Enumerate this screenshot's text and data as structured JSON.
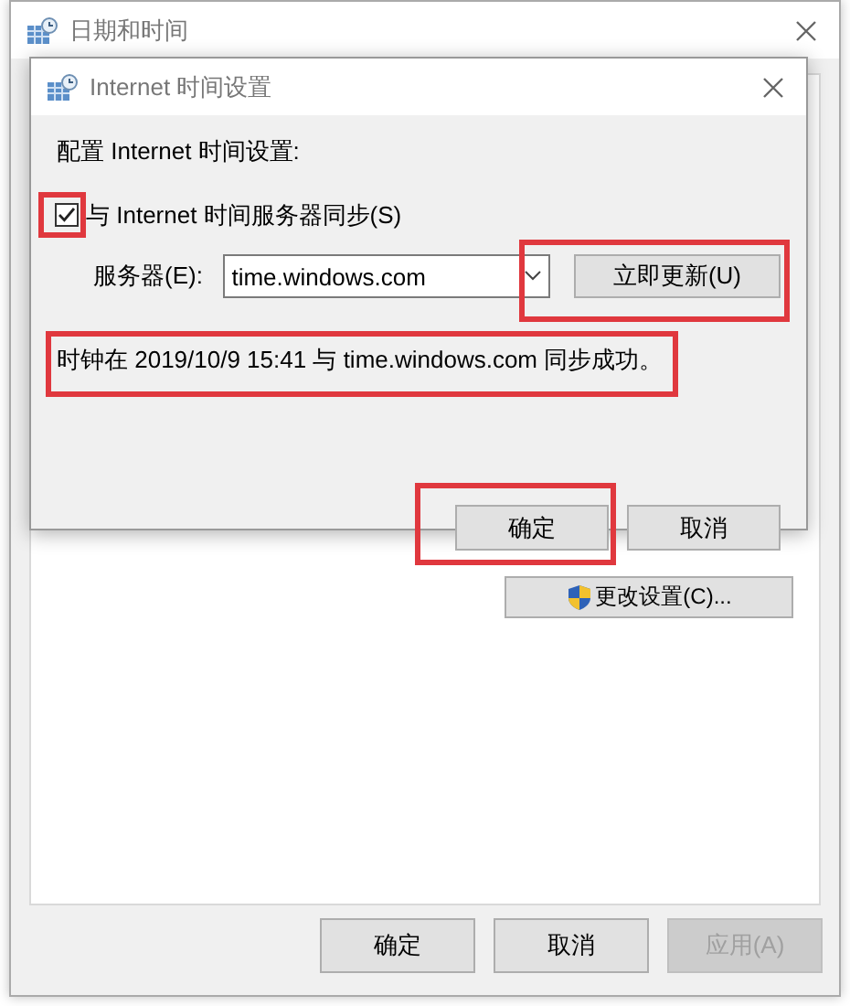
{
  "window": {
    "title": "日期和时间",
    "change_settings_button": "更改设置(C)...",
    "buttons": [
      {
        "label": "确定",
        "disabled": false
      },
      {
        "label": "取消",
        "disabled": false
      },
      {
        "label": "应用(A)",
        "disabled": true
      }
    ]
  },
  "dialog": {
    "title": "Internet 时间设置",
    "heading": "配置 Internet 时间设置:",
    "sync": {
      "label": "与 Internet 时间服务器同步(S)",
      "checked": true,
      "highlighted": true
    },
    "server_label": "服务器(E):",
    "server_value": "time.windows.com",
    "update_button": {
      "label": "立即更新(U)",
      "highlighted": true
    },
    "status": {
      "text": "时钟在 2019/10/9 15:41 与 time.windows.com 同步成功。",
      "highlighted": true
    },
    "buttons": [
      {
        "label": "确定",
        "highlighted": true
      },
      {
        "label": "取消",
        "highlighted": false
      }
    ]
  }
}
